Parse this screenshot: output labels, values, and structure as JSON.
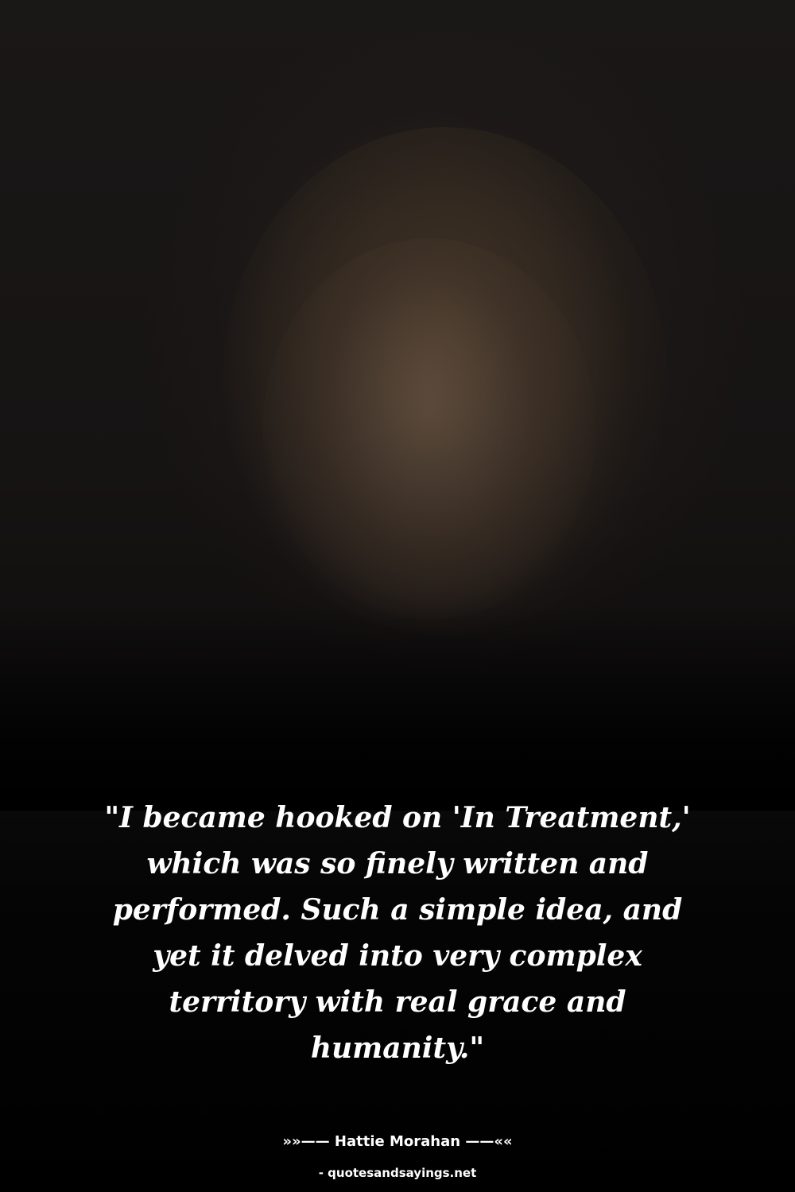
{
  "quote": {
    "text": "\"I became hooked on 'In Treatment,' which was so finely written and performed. Such a simple idea, and yet it delved into very complex territory with real grace and humanity.\""
  },
  "attribution": {
    "text": "»»—— Hattie Morahan ——««"
  },
  "source": {
    "text": "- quotesandsayings.net"
  },
  "colors": {
    "text": "#ffffff",
    "background": "#000000"
  }
}
